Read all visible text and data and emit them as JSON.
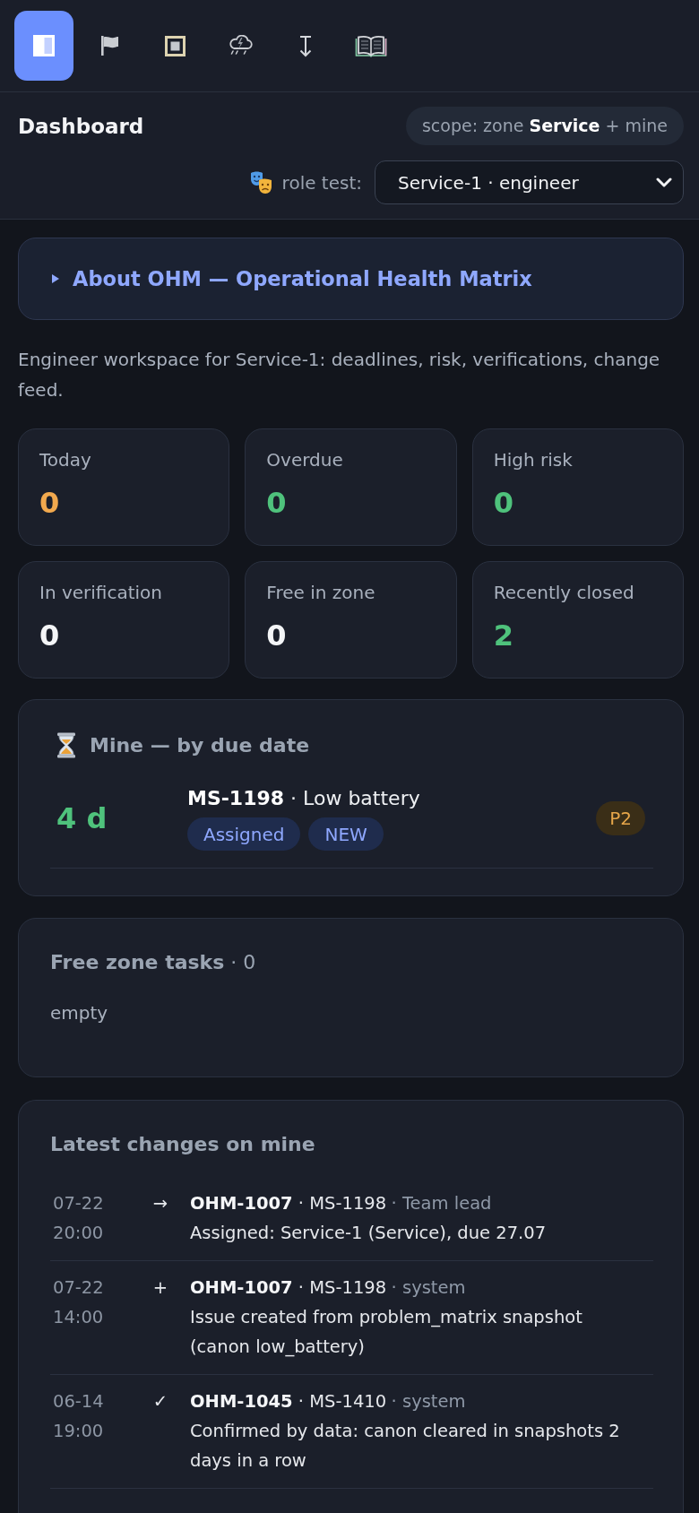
{
  "toolbar": [
    {
      "selected": true
    },
    {
      "selected": false
    },
    {
      "selected": false
    },
    {
      "selected": false
    },
    {
      "selected": false
    },
    {
      "selected": false
    }
  ],
  "header": {
    "title": "Dashboard",
    "scope": "scope: zone **Service** + mine",
    "role_label": "role test:",
    "role_select": {
      "value": "Service-1 · engineer"
    }
  },
  "about": {
    "title": "About OHM — Operational Health Matrix",
    "expanded": false
  },
  "description": "Engineer workspace for Service-1: deadlines, risk, verifications, change feed.",
  "stats": [
    {
      "label": "Today",
      "value": "0",
      "color": "#f2a94e"
    },
    {
      "label": "Overdue",
      "value": "0",
      "color": "#4fc27c"
    },
    {
      "label": "High risk",
      "value": "0",
      "color": "#4fc27c"
    },
    {
      "label": "In verification",
      "value": "0",
      "color": "#f4f5f7"
    },
    {
      "label": "Free in zone",
      "value": "0",
      "color": "#f4f5f7"
    },
    {
      "label": "Recently closed",
      "value": "2",
      "color": "#4fc27c"
    }
  ],
  "mine": {
    "title": "Mine — by due date",
    "items": [
      {
        "due": "4 d",
        "title": "**MS-1198** · Low battery",
        "tags": [
          "Assigned",
          "NEW"
        ],
        "priority": "P2"
      }
    ]
  },
  "free_tasks": {
    "title": "**Free zone tasks** · 0",
    "empty_text": "empty"
  },
  "changes": {
    "title": "Latest changes on mine",
    "items": [
      {
        "date": "07-22",
        "time": "20:00",
        "symbol": "→",
        "title": "**OHM-1007** · MS-1198",
        "actor": "· Team lead",
        "text": "Assigned: Service-1 (Service), due 27.07"
      },
      {
        "date": "07-22",
        "time": "14:00",
        "symbol": "+",
        "title": "**OHM-1007** · MS-1198",
        "actor": "· system",
        "text": "Issue created from problem_matrix snapshot (canon low_battery)"
      },
      {
        "date": "06-14",
        "time": "19:00",
        "symbol": "✓",
        "title": "**OHM-1045** · MS-1410",
        "actor": "· system",
        "text": "Confirmed by data: canon cleared in snapshots 2 days in a row"
      }
    ]
  }
}
